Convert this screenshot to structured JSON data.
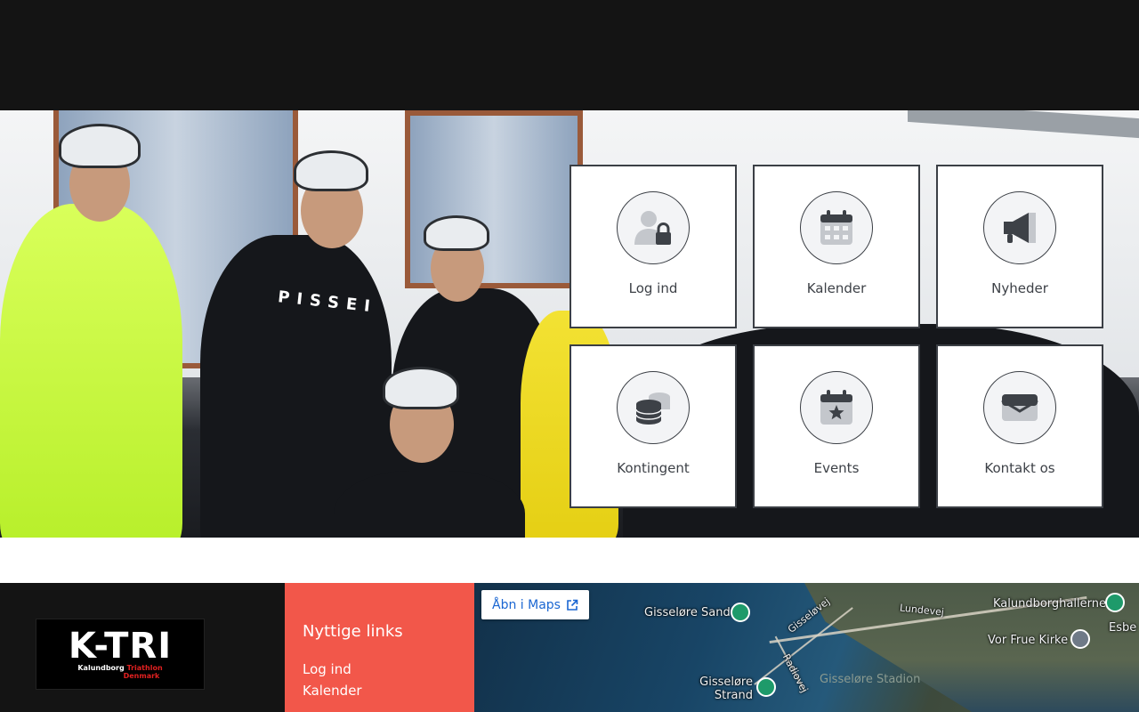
{
  "hero": {
    "jersey_text": "PISSEI"
  },
  "tiles": [
    {
      "label": "Log ind",
      "icon": "user-lock-icon"
    },
    {
      "label": "Kalender",
      "icon": "calendar-icon"
    },
    {
      "label": "Nyheder",
      "icon": "megaphone-icon"
    },
    {
      "label": "Kontingent",
      "icon": "coins-icon"
    },
    {
      "label": "Events",
      "icon": "calendar-star-icon"
    },
    {
      "label": "Kontakt os",
      "icon": "envelope-icon"
    }
  ],
  "footer": {
    "logo": {
      "main": "K-TRI",
      "line1_white": "Kalundborg",
      "line1_red": "Triathlon",
      "line2": "Denmark"
    },
    "links_title": "Nyttige links",
    "links": [
      "Log ind",
      "Kalender"
    ]
  },
  "map": {
    "open_button": "Åbn i Maps",
    "places": [
      "Gisseløre Sand",
      "Gisseløre Strand",
      "Gisseløre Stadion",
      "Lundevej",
      "Gisseløvej",
      "Radiovej",
      "Kalundborghallerne",
      "Vor Frue Kirke",
      "Esbe"
    ]
  },
  "colors": {
    "accent_red": "#f2574a",
    "dark": "#141414",
    "tile_border": "#3b3f45",
    "link_blue": "#1a66d2"
  }
}
